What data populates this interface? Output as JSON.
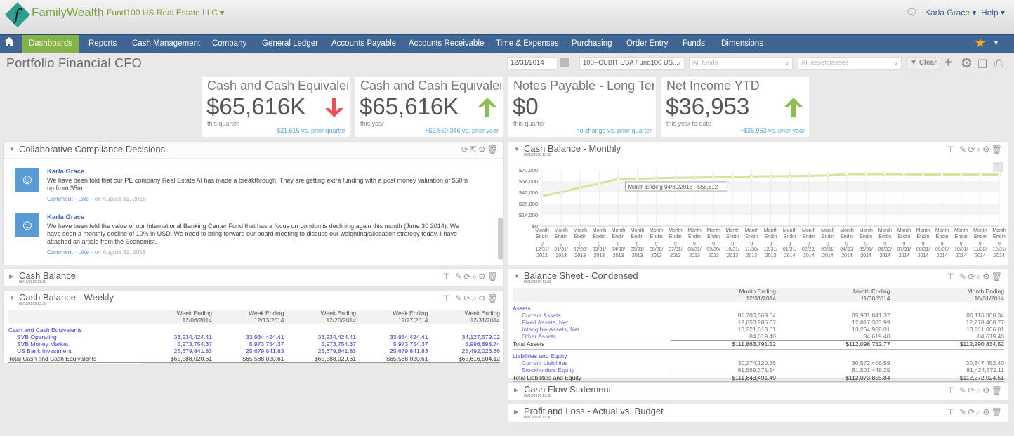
{
  "app": {
    "brand": "FamilyWealth",
    "entity": "Fund100 US Real Estate LLC",
    "user": "Karla Grace",
    "help": "Help",
    "logo_letter": "f"
  },
  "nav": {
    "items": [
      "Dashboards",
      "Reports",
      "Cash Management",
      "Company",
      "General Ledger",
      "Accounts Payable",
      "Accounts Receivable",
      "Time & Expenses",
      "Purchasing",
      "Order Entry",
      "Funds",
      "Dimensions"
    ],
    "active": "Dashboards"
  },
  "page": {
    "title": "Portfolio Financial CFO"
  },
  "filters": {
    "date": "12/31/2014",
    "entity": "100--CUBIT USA Fund100 US...",
    "funds_placeholder": "All funds",
    "assetclasses_placeholder": "All assetclasses",
    "clear_label": "Clear"
  },
  "kpis": [
    {
      "title": "Cash and Cash Equivalen…",
      "value": "$65,616K",
      "period": "this quarter",
      "compare": "-$31,615 vs. prior quarter",
      "trend": "down",
      "trend_color": "#e9505a"
    },
    {
      "title": "Cash and Cash Equivalen…",
      "value": "$65,616K",
      "period": "this year",
      "compare": "+$2,550,346 vs. prior year",
      "trend": "up",
      "trend_color": "#8cc152"
    },
    {
      "title": "Notes Payable - Long Term",
      "value": "$0",
      "period": "this quarter",
      "compare": "no change vs. prior quarter",
      "trend": "none"
    },
    {
      "title": "Net Income YTD",
      "value": "$36,953",
      "period": "this year to date",
      "compare": "+$36,953 vs. prior year",
      "trend": "up",
      "trend_color": "#8cc152"
    }
  ],
  "compliance": {
    "title": "Collaborative Compliance Decisions",
    "posts": [
      {
        "author": "Karla Grace",
        "text": "We have been told that our PE company Real Estate AI has made a breakthrough. They are getting extra funding with a post money valuation of $50m up from $5m.",
        "comment": "Comment",
        "like": "Like",
        "date": "on August 31, 2016"
      },
      {
        "author": "Karla Grace",
        "text": "We have been told the value of our International Banking Center Fund that has a focus on London is declining again this month (June 30 2014). We have seen a monthly decline of 10% in USD. We need to bring forward our board meeting to discuss our weighting/allocation strategy today. I have attached an article from the Economist.",
        "comment": "Comment",
        "like": "Like",
        "date": "on August 31, 2016"
      }
    ]
  },
  "panels": {
    "cash_balance": {
      "title": "Cash Balance",
      "date": "09/13/2016 13:30"
    },
    "cash_weekly": {
      "title": "Cash Balance - Weekly",
      "date": "09/13/2016 13:30"
    },
    "cash_monthly": {
      "title": "Cash Balance - Monthly",
      "date": "09/13/2016 13:30"
    },
    "balance_sheet": {
      "title": "Balance Sheet - Condensed",
      "date": "09/13/2016 13:30"
    },
    "cash_flow": {
      "title": "Cash Flow Statement",
      "date": "09/13/2016 13:30"
    },
    "pnl": {
      "title": "Profit and Loss - Actual vs. Budget",
      "date": "09/13/2016 13:30"
    }
  },
  "weekly_table": {
    "columns": [
      [
        "Week Ending",
        "12/06/2014"
      ],
      [
        "Week Ending",
        "12/13/2014"
      ],
      [
        "Week Ending",
        "12/20/2014"
      ],
      [
        "Week Ending",
        "12/27/2014"
      ],
      [
        "Week Ending",
        "12/31/2014"
      ]
    ],
    "group": "Cash and Cash Equivalents",
    "rows": [
      {
        "label": "SVB Operating",
        "values": [
          "33,934,424.41",
          "33,934,424.41",
          "33,934,424.41",
          "33,934,424.41",
          "34,127,579.02"
        ]
      },
      {
        "label": "SVB Money Market",
        "values": [
          "5,973,754.37",
          "5,973,754.37",
          "5,973,754.37",
          "5,973,754.37",
          "5,996,898.74"
        ]
      },
      {
        "label": "US Bank Investment",
        "values": [
          "25,679,841.83",
          "25,679,841.83",
          "25,679,841.83",
          "25,679,841.83",
          "25,492,026.36"
        ]
      }
    ],
    "total": {
      "label": "Total Cash and Cash Equivalents",
      "values": [
        "$65,588,020.61",
        "$65,588,020.61",
        "$65,588,020.61",
        "$65,588,020.61",
        "$65,616,504.12"
      ]
    }
  },
  "balance_table": {
    "columns": [
      [
        "Month Ending",
        "12/31/2014"
      ],
      [
        "Month Ending",
        "11/30/2014"
      ],
      [
        "Month Ending",
        "10/31/2014"
      ]
    ],
    "sections": [
      {
        "label": "Assets",
        "rows": [
          {
            "label": "Current Assets",
            "values": [
              "85,703,569.04",
              "85,931,841.37",
              "86,116,800.34"
            ]
          },
          {
            "label": "Fixed Assets, Net",
            "values": [
              "12,853,985.07",
              "12,817,383.99",
              "12,778,408.77"
            ]
          },
          {
            "label": "Intangible Assets, Net",
            "values": [
              "13,221,618.01",
              "13,264,908.01",
              "13,311,006.01"
            ]
          },
          {
            "label": "Other Assets",
            "values": [
              "84,619.40",
              "84,619.40",
              "84,619.40"
            ]
          }
        ],
        "total": {
          "label": "Total Assets",
          "values": [
            "$111,863,791.52",
            "$112,098,752.77",
            "$112,290,834.52"
          ]
        }
      },
      {
        "label": "Liabilities and Equity",
        "rows": [
          {
            "label": "Current Liabilities",
            "values": [
              "30,274,120.35",
              "30,572,406.59",
              "30,847,452.40"
            ]
          },
          {
            "label": "Stockholders Equity",
            "values": [
              "81,569,371.14",
              "81,501,449.25",
              "81,424,572.11"
            ]
          }
        ],
        "total": {
          "label": "Total Liabilities and Equity",
          "values": [
            "$111,843,491.49",
            "$112,073,855.84",
            "$112,272,024.51"
          ]
        }
      }
    ]
  },
  "chart_data": {
    "type": "line",
    "title": "Cash Balance - Monthly",
    "xlabel": "",
    "ylabel": "",
    "ylim": [
      0,
      70000
    ],
    "yticks": [
      "$0",
      "$14,000",
      "$28,000",
      "$42,000",
      "$56,000",
      "$70,000"
    ],
    "grid": true,
    "line_color": "#d4e49a",
    "tooltip": "Month Ending 04/30/2013 - $58,612",
    "x": [
      "12/31/2012",
      "01/31/2013",
      "02/28/2013",
      "03/31/2013",
      "04/30/2013",
      "05/31/2013",
      "06/30/2013",
      "07/31/2013",
      "08/31/2013",
      "09/30/2013",
      "10/31/2013",
      "11/30/2013",
      "12/31/2013",
      "01/31/2014",
      "02/28/2014",
      "03/31/2014",
      "04/30/2014",
      "05/31/2014",
      "06/30/2014",
      "07/31/2014",
      "08/31/2014",
      "09/30/2014",
      "10/31/2014",
      "11/30/2014",
      "12/31/2014"
    ],
    "x_prefix": "Month Ending",
    "series": [
      {
        "name": "Cash Balance",
        "values": [
          37600,
          42000,
          48000,
          53000,
          58612,
          59000,
          59600,
          60200,
          60500,
          60800,
          61200,
          61800,
          62200,
          62200,
          62600,
          63200,
          64800,
          64800,
          64700,
          64600,
          64300,
          64300,
          64200,
          64200,
          64200
        ]
      }
    ]
  }
}
